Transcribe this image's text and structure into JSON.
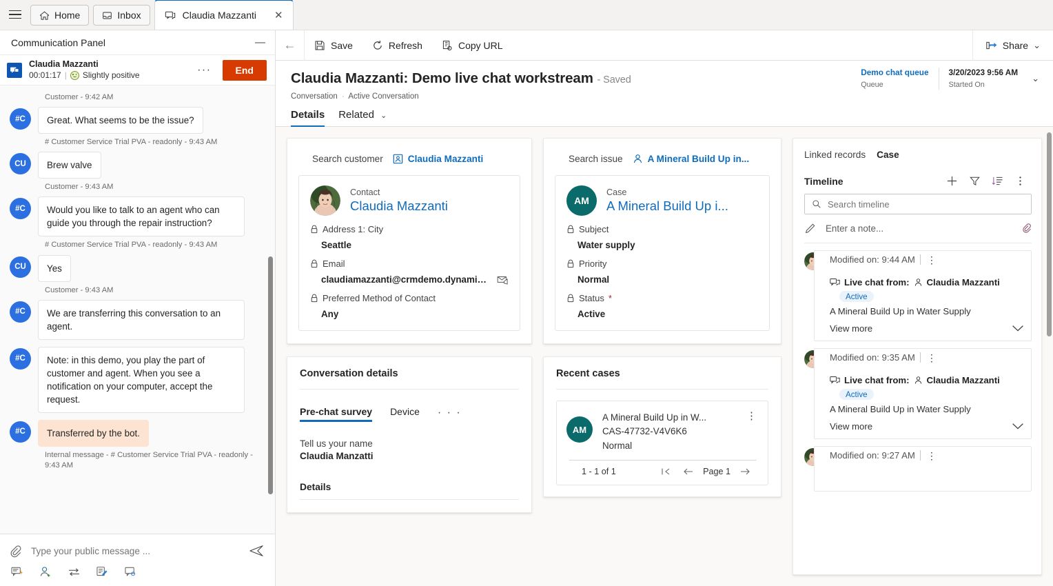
{
  "tabbar": {
    "home_label": "Home",
    "inbox_label": "Inbox",
    "active_tab_label": "Claudia Mazzanti",
    "close_glyph": "✕"
  },
  "communication_panel": {
    "title": "Communication Panel",
    "minimize_glyph": "—",
    "session": {
      "customer_name": "Claudia Mazzanti",
      "timer": "00:01:17",
      "separator": "|",
      "sentiment": "Slightly positive",
      "more_glyph": "···",
      "end_label": "End"
    },
    "messages": [
      {
        "kind": "meta_only",
        "meta": "Customer - 9:42 AM"
      },
      {
        "kind": "bot",
        "avatar": "#C",
        "text": "Great. What seems to be the issue?",
        "meta": "# Customer Service Trial PVA - readonly - 9:43 AM"
      },
      {
        "kind": "customer",
        "avatar": "CU",
        "text": "Brew valve",
        "meta": "Customer - 9:43 AM"
      },
      {
        "kind": "bot",
        "avatar": "#C",
        "text": "Would you like to talk to an agent who can guide you through the repair instruction?",
        "meta": "# Customer Service Trial PVA - readonly - 9:43 AM"
      },
      {
        "kind": "customer",
        "avatar": "CU",
        "text": "Yes",
        "meta": "Customer - 9:43 AM"
      },
      {
        "kind": "bot",
        "avatar": "#C",
        "text": "We are transferring this conversation to an agent.",
        "meta": ""
      },
      {
        "kind": "bot",
        "avatar": "#C",
        "text": "Note: in this demo, you play the part of customer and agent. When you see a notification on your computer, accept the request.",
        "meta": ""
      },
      {
        "kind": "internal",
        "avatar": "#C",
        "text": "Transferred by the bot.",
        "meta": "Internal message - # Customer Service Trial PVA - readonly - 9:43 AM"
      }
    ],
    "composer": {
      "placeholder": "Type your public message ...",
      "attach_icon": "paperclip-icon",
      "send_icon": "send-icon",
      "tools": [
        "quick-replies-icon",
        "add-agent-icon",
        "transfer-icon",
        "notes-icon",
        "consult-icon"
      ]
    }
  },
  "command_bar": {
    "back_glyph": "←",
    "save_label": "Save",
    "refresh_label": "Refresh",
    "copy_url_label": "Copy URL",
    "share_label": "Share",
    "share_chevron": "⌄"
  },
  "record": {
    "title": "Claudia Mazzanti: Demo live chat workstream",
    "saved_suffix": "- Saved",
    "breadcrumb_entity": "Conversation",
    "breadcrumb_sep": "·",
    "breadcrumb_view": "Active Conversation",
    "header_fields": [
      {
        "value": "Demo chat queue",
        "label": "Queue",
        "is_link": true
      },
      {
        "value": "3/20/2023 9:56 AM",
        "label": "Started On",
        "is_link": false
      }
    ],
    "header_chevron": "⌄",
    "tabs": [
      {
        "label": "Details",
        "active": true,
        "has_chevron": false
      },
      {
        "label": "Related",
        "active": false,
        "has_chevron": true
      }
    ],
    "tab_chevron": "⌄"
  },
  "customer_panel": {
    "search_label": "Search customer",
    "search_value": "Claudia Mazzanti",
    "entity_type": "Contact",
    "entity_name": "Claudia Mazzanti",
    "fields": [
      {
        "label": "Address 1: City",
        "value": "Seattle",
        "locked": true,
        "required": false,
        "trailing_icon": ""
      },
      {
        "label": "Email",
        "value": "claudiamazzanti@crmdemo.dynamics....",
        "locked": true,
        "required": false,
        "trailing_icon": "email-icon"
      },
      {
        "label": "Preferred Method of Contact",
        "value": "Any",
        "locked": true,
        "required": false,
        "trailing_icon": ""
      }
    ]
  },
  "issue_panel": {
    "search_label": "Search issue",
    "search_value": "A Mineral Build Up in...",
    "entity_type": "Case",
    "entity_initials": "AM",
    "entity_name": "A Mineral Build Up i...",
    "fields": [
      {
        "label": "Subject",
        "value": "Water supply",
        "locked": true,
        "required": false
      },
      {
        "label": "Priority",
        "value": "Normal",
        "locked": true,
        "required": false
      },
      {
        "label": "Status",
        "value": "Active",
        "locked": true,
        "required": true
      }
    ]
  },
  "conversation_details": {
    "title": "Conversation details",
    "tabs": [
      {
        "label": "Pre-chat survey",
        "active": true
      },
      {
        "label": "Device",
        "active": false
      }
    ],
    "overflow_glyph": "· · ·",
    "survey": [
      {
        "question": "Tell us your name",
        "answer": "Claudia Manzatti"
      }
    ],
    "details_label": "Details"
  },
  "recent_cases": {
    "title": "Recent cases",
    "items": [
      {
        "initials": "AM",
        "title": "A Mineral Build Up in W...",
        "number": "CAS-47732-V4V6K6",
        "priority": "Normal",
        "more_glyph": "⋮"
      }
    ],
    "pager": {
      "count": "1 - 1 of 1",
      "first_glyph": "⏮",
      "prev_glyph": "←",
      "page_label": "Page 1",
      "next_glyph": "→"
    }
  },
  "timeline_panel": {
    "linked_records_label": "Linked records",
    "linked_records_value": "Case",
    "title": "Timeline",
    "actions": [
      "add-icon",
      "filter-icon",
      "sort-icon",
      "more-icon"
    ],
    "search_placeholder": "Search timeline",
    "note_placeholder": "Enter a note...",
    "attach_icon": "paperclip-icon",
    "items": [
      {
        "modified": "Modified on: 9:44 AM",
        "source_label": "Live chat from:",
        "person": "Claudia Mazzanti",
        "status": "Active",
        "subject": "A Mineral Build Up in Water Supply",
        "view_more": "View more",
        "more_glyph": "⋮",
        "chevron": "⌄"
      },
      {
        "modified": "Modified on: 9:35 AM",
        "source_label": "Live chat from:",
        "person": "Claudia Mazzanti",
        "status": "Active",
        "subject": "A Mineral Build Up in Water Supply",
        "view_more": "View more",
        "more_glyph": "⋮",
        "chevron": "⌄"
      },
      {
        "modified": "Modified on: 9:27 AM",
        "source_label": "",
        "person": "",
        "status": "",
        "subject": "",
        "view_more": "",
        "more_glyph": "⋮",
        "chevron": ""
      }
    ]
  },
  "colors": {
    "accent": "#0f6cbd",
    "end_button": "#d83b01",
    "avatar_blue": "#2b6fe0",
    "case_teal": "#0b6a6a",
    "internal_message": "#fce3d2",
    "badge_bg": "#eaf2fb"
  }
}
